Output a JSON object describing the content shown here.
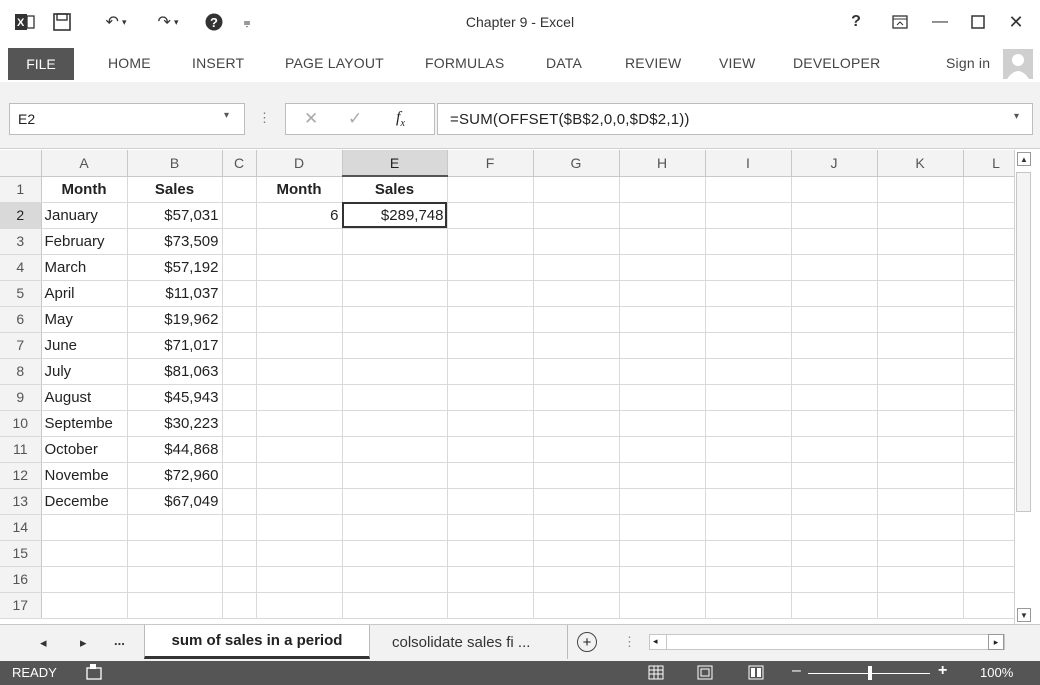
{
  "window": {
    "title": "Chapter 9 - Excel",
    "help": "?",
    "sign_in": "Sign in"
  },
  "ribbon": {
    "tabs": [
      "FILE",
      "HOME",
      "INSERT",
      "PAGE LAYOUT",
      "FORMULAS",
      "DATA",
      "REVIEW",
      "VIEW",
      "DEVELOPER"
    ]
  },
  "formula_bar": {
    "name_box": "E2",
    "formula": "=SUM(OFFSET($B$2,0,0,$D$2,1))"
  },
  "sheet": {
    "columns": [
      "A",
      "B",
      "C",
      "D",
      "E",
      "F",
      "G",
      "H",
      "I",
      "J",
      "K",
      "L"
    ],
    "selected_cell": "E2",
    "rows": [
      {
        "n": "1",
        "A": "Month",
        "B": "Sales",
        "D": "Month",
        "E": "Sales"
      },
      {
        "n": "2",
        "A": "January",
        "B": "$57,031",
        "D": "6",
        "E": "$289,748"
      },
      {
        "n": "3",
        "A": "February",
        "B": "$73,509"
      },
      {
        "n": "4",
        "A": "March",
        "B": "$57,192"
      },
      {
        "n": "5",
        "A": "April",
        "B": "$11,037"
      },
      {
        "n": "6",
        "A": "May",
        "B": "$19,962"
      },
      {
        "n": "7",
        "A": "June",
        "B": "$71,017"
      },
      {
        "n": "8",
        "A": "July",
        "B": "$81,063"
      },
      {
        "n": "9",
        "A": "August",
        "B": "$45,943"
      },
      {
        "n": "10",
        "A": "Septembe",
        "B": "$30,223"
      },
      {
        "n": "11",
        "A": "October",
        "B": "$44,868"
      },
      {
        "n": "12",
        "A": "Novembe",
        "B": "$72,960"
      },
      {
        "n": "13",
        "A": "Decembe",
        "B": "$67,049"
      },
      {
        "n": "14"
      },
      {
        "n": "15"
      },
      {
        "n": "16"
      },
      {
        "n": "17"
      }
    ]
  },
  "sheet_tabs": {
    "ellipsis": "...",
    "active": "sum of sales in a period",
    "second": "colsolidate sales fі ...",
    "add": "+"
  },
  "status": {
    "mode": "READY",
    "zoom": "100%"
  },
  "colors": {
    "status_bar": "#555555",
    "file_tab": "#555555",
    "header_bg": "#f3f3f3"
  }
}
